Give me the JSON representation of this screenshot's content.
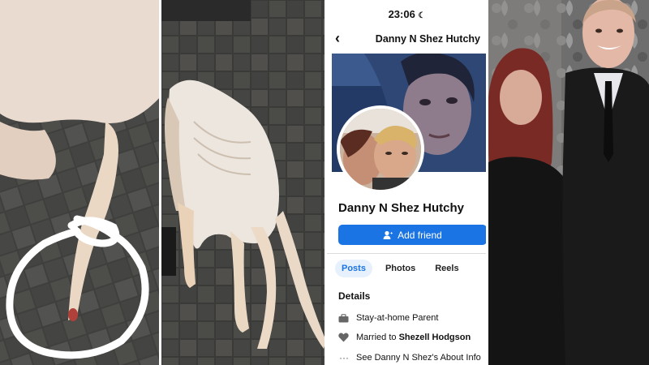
{
  "status_bar": {
    "time": "23:06",
    "moon": "☾"
  },
  "profile": {
    "header_name": "Danny N Shez Hutchy",
    "back_glyph": "‹",
    "name": "Danny N Shez Hutchy",
    "add_friend_label": "Add friend",
    "tabs": [
      {
        "label": "Posts",
        "active": true
      },
      {
        "label": "Photos",
        "active": false
      },
      {
        "label": "Reels",
        "active": false
      }
    ],
    "details_heading": "Details",
    "details": {
      "job": "Stay-at-home Parent",
      "married_prefix": "Married to",
      "married_name": "Shezell Hodgson",
      "see_about": "See Danny N Shez's About Info"
    }
  },
  "colors": {
    "accent": "#1b74e4",
    "tab_active_bg": "#e7f0fd"
  },
  "icons": [
    "chevron-left-icon",
    "add-person-icon",
    "briefcase-icon",
    "heart-icon",
    "more-icon"
  ]
}
